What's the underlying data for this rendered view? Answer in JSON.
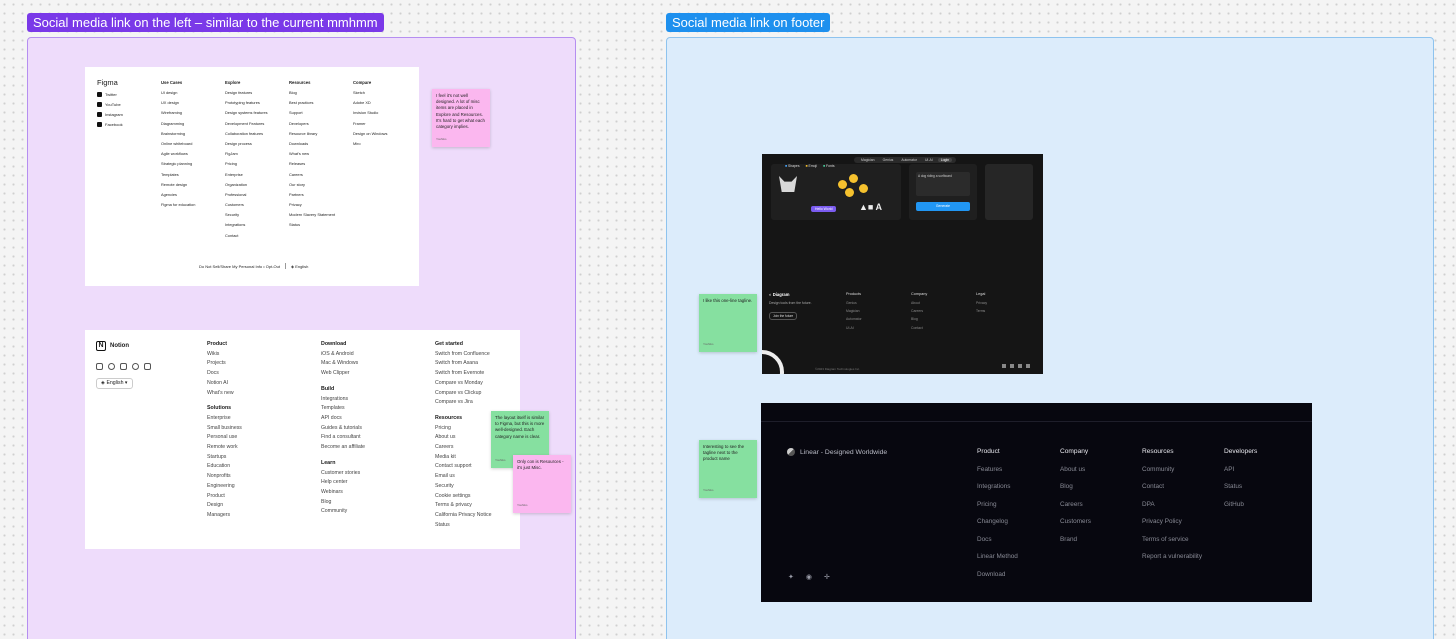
{
  "left_section": {
    "tag": "Social media link on the left – similar to the current mmhmm",
    "tag_color": "#7a39e8",
    "bg_color": "#eedcfb",
    "figma": {
      "logo": "Figma",
      "social": [
        "Twitter",
        "YouTube",
        "Instagram",
        "Facebook"
      ],
      "columns": [
        {
          "title": "Use Cases",
          "items": [
            "UI design",
            "UX design",
            "Wireframing",
            "Diagramming",
            "Brainstorming",
            "Online whiteboard",
            "Agile workflows",
            "Strategic planning",
            "Templates",
            "Remote design",
            "Agencies",
            "Figma for education"
          ]
        },
        {
          "title": "Explore",
          "items": [
            "Design features",
            "Prototyping features",
            "Design systems features",
            "Development Features",
            "Collaboration features",
            "Design process",
            "FigJam",
            "Pricing",
            "Enterprise",
            "Organization",
            "Professional",
            "Customers",
            "Security",
            "Integrations",
            "Contact"
          ]
        },
        {
          "title": "Resources",
          "items": [
            "Blog",
            "Best practices",
            "Support",
            "Developers",
            "Resource library",
            "Downloads",
            "What’s new",
            "Releases",
            "Careers",
            "Our story",
            "Partners",
            "Privacy",
            "Modern Slavery Statement",
            "Status"
          ]
        },
        {
          "title": "Compare",
          "items": [
            "Sketch",
            "Adobe XD",
            "Invision Studio",
            "Framer",
            "Design on Windows",
            "Miro"
          ]
        }
      ],
      "bottom_link": "Do Not Sell/Share My Personal Info • Opt-Out",
      "language": "English",
      "sticky": {
        "text": "I feel it's not well designed. A lot of misc items are placed in Explore and Resources. It's hard to get what each category implies.",
        "author": "Yoshiko",
        "color": "#fbb7ef"
      }
    },
    "notion": {
      "logo": "Notion",
      "language": "English",
      "columns": [
        {
          "groups": [
            {
              "title": "Product",
              "items": [
                "Wikis",
                "Projects",
                "Docs",
                "Notion AI",
                "What's new"
              ]
            },
            {
              "title": "Solutions",
              "items": [
                "Enterprise",
                "Small business",
                "Personal use",
                "Remote work",
                "Startups",
                "Education",
                "Nonprofits",
                "Engineering",
                "Product",
                "Design",
                "Managers"
              ]
            }
          ]
        },
        {
          "groups": [
            {
              "title": "Download",
              "items": [
                "iOS & Android",
                "Mac & Windows",
                "Web Clipper"
              ]
            },
            {
              "title": "Build",
              "items": [
                "Integrations",
                "Templates",
                "API docs",
                "Guides & tutorials",
                "Find a consultant",
                "Become an affiliate"
              ]
            },
            {
              "title": "Learn",
              "items": [
                "Customer stories",
                "Help center",
                "Webinars",
                "Blog",
                "Community"
              ]
            }
          ]
        },
        {
          "groups": [
            {
              "title": "Get started",
              "items": [
                "Switch from Confluence",
                "Switch from Asana",
                "Switch from Evernote",
                "Compare vs Monday",
                "Compare vs Clickup",
                "Compare vs Jira"
              ]
            },
            {
              "title": "Resources",
              "items": [
                "Pricing",
                "About us",
                "Careers",
                "Media kit",
                "Contact support",
                "Email us",
                "Security",
                "Cookie settings",
                "Terms & privacy",
                "California Privacy Notice",
                "Status"
              ]
            }
          ]
        }
      ],
      "sticky_green": {
        "text": "The layout itself is similar to Figma, but this is more well-designed. Each category name is clear.",
        "author": "Yoshiko",
        "color": "#86e0a0"
      },
      "sticky_pink": {
        "text": "Only con is Resources - it's just Misc.",
        "author": "Yoshiko",
        "color": "#fbb7ef"
      }
    }
  },
  "right_section": {
    "tag": "Social media link on footer",
    "tag_color": "#1e90ee",
    "bg_color": "#dcecfb",
    "diagram": {
      "nav": [
        "Magician",
        "Genius",
        "Automator",
        "UI-AI",
        "Login"
      ],
      "chips": [
        "Shapes",
        "Emoji",
        "Fonts"
      ],
      "hello_button": "Hello World",
      "prompt_text": "A dog riding a surfboard",
      "generate": "Generate",
      "brand": "Diagram",
      "tagline": "Design tools from the future.",
      "join": "Join the future",
      "columns": [
        {
          "title": "Products",
          "items": [
            "Genius",
            "Magician",
            "Automator",
            "UI-AI"
          ]
        },
        {
          "title": "Company",
          "items": [
            "About",
            "Careers",
            "Blog",
            "Contact"
          ]
        },
        {
          "title": "Legal",
          "items": [
            "Privacy",
            "Terms"
          ]
        }
      ],
      "copyright": "©2023 Diagram Technologies Inc.",
      "sticky": {
        "text": "I like this one-line tagline.",
        "author": "Yoshiko",
        "color": "#86e0a0"
      }
    },
    "linear": {
      "brand": "Linear - Designed Worldwide",
      "columns": [
        {
          "title": "Product",
          "items": [
            "Features",
            "Integrations",
            "Pricing",
            "Changelog",
            "Docs",
            "Linear Method",
            "Download"
          ]
        },
        {
          "title": "Company",
          "items": [
            "About us",
            "Blog",
            "Careers",
            "Customers",
            "Brand"
          ]
        },
        {
          "title": "Resources",
          "items": [
            "Community",
            "Contact",
            "DPA",
            "Privacy Policy",
            "Terms of service",
            "Report a vulnerability"
          ]
        },
        {
          "title": "Developers",
          "items": [
            "API",
            "Status",
            "GitHub"
          ]
        }
      ],
      "sticky": {
        "text": "Interesting to see the tagline next to the product name",
        "author": "Yoshiko",
        "color": "#86e0a0"
      }
    }
  }
}
